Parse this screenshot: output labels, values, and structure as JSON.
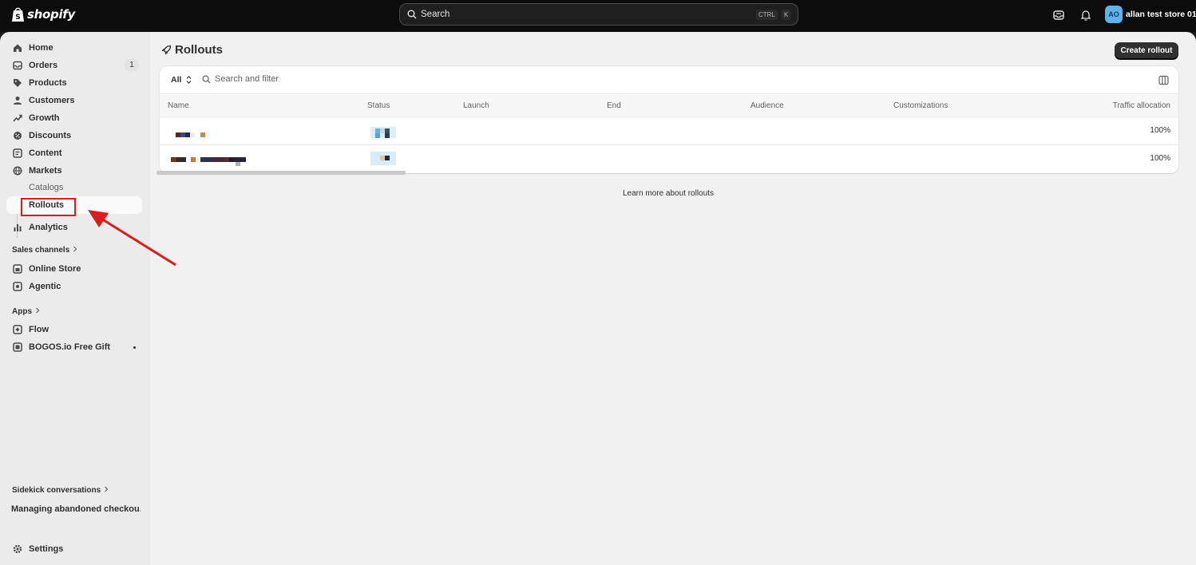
{
  "topbar": {
    "brand": "shopify",
    "search_label": "Search",
    "shortcut_ctrl": "CTRL",
    "shortcut_k": "K",
    "avatar_initials": "AO",
    "store_name": "allan test store 01"
  },
  "sidebar": {
    "items": [
      {
        "label": "Home",
        "icon": "home-icon"
      },
      {
        "label": "Orders",
        "icon": "orders-icon",
        "badge": "1"
      },
      {
        "label": "Products",
        "icon": "tag-icon"
      },
      {
        "label": "Customers",
        "icon": "person-icon"
      },
      {
        "label": "Growth",
        "icon": "growth-icon"
      },
      {
        "label": "Discounts",
        "icon": "discount-icon"
      },
      {
        "label": "Content",
        "icon": "content-icon"
      },
      {
        "label": "Markets",
        "icon": "globe-icon"
      }
    ],
    "sub_items": [
      {
        "label": "Catalogs"
      },
      {
        "label": "Rollouts",
        "active": true
      }
    ],
    "analytics": "Analytics",
    "sales_channels_heading": "Sales channels",
    "sales_channels": [
      {
        "label": "Online Store",
        "icon": "store-icon"
      },
      {
        "label": "Agentic",
        "icon": "agentic-icon"
      }
    ],
    "apps_heading": "Apps",
    "apps": [
      {
        "label": "Flow",
        "icon": "flow-icon"
      },
      {
        "label": "BOGOS.io Free Gift",
        "icon": "app-icon"
      }
    ],
    "sidekick_heading": "Sidekick conversations",
    "sidekick_item": "Managing abandoned checkou...",
    "settings": "Settings"
  },
  "main": {
    "title": "Rollouts",
    "create_button": "Create rollout",
    "filter_all": "All",
    "search_placeholder": "Search and filter",
    "columns": [
      "Name",
      "Status",
      "Launch",
      "End",
      "Audience",
      "Customizations",
      "Traffic allocation"
    ],
    "rows": [
      {
        "traffic": "100%"
      },
      {
        "traffic": "100%"
      }
    ],
    "learn_more": "Learn more about rollouts"
  },
  "colors": {
    "annotation": "#e01b1b",
    "topbar": "#0c0c0c",
    "primary_button": "#303030"
  }
}
